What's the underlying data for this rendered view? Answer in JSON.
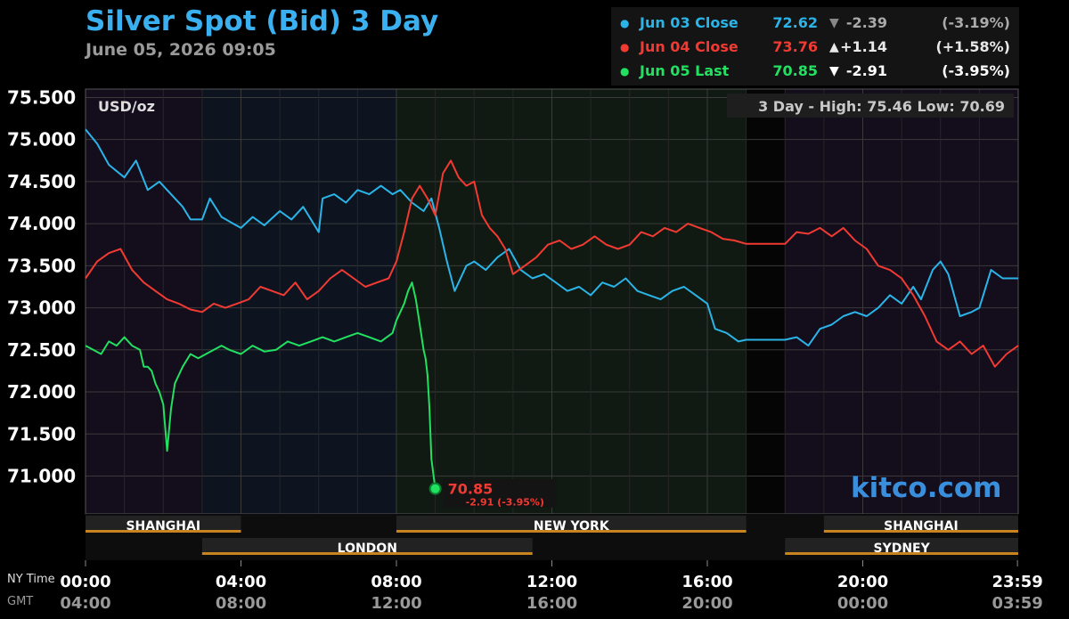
{
  "header": {
    "title": "Silver Spot (Bid) 3 Day",
    "subtitle": "June 05, 2026 09:05"
  },
  "legend": [
    {
      "name": "Jun 03 Close",
      "value": "72.62",
      "arrow": "▼",
      "change": "-2.39",
      "pct": "(-3.19%)",
      "color": "#2ab4e8",
      "arrow_color": "#888888",
      "change_color": "#aaaaaa"
    },
    {
      "name": "Jun 04 Close",
      "value": "73.76",
      "arrow": "▲",
      "change": "+1.14",
      "pct": "(+1.58%)",
      "color": "#f03a32",
      "arrow_color": "#e8e8e8",
      "change_color": "#e8e8e8"
    },
    {
      "name": "Jun 05 Last",
      "value": "70.85",
      "arrow": "▼",
      "change": "-2.91",
      "pct": "(-3.95%)",
      "color": "#22e060",
      "arrow_color": "#ffffff",
      "change_color": "#ffffff"
    }
  ],
  "brand": "kitco.com",
  "chart_data": {
    "type": "line",
    "unit_label": "USD/oz",
    "range_text": "3 Day - High: 75.46  Low: 70.69",
    "ylim": [
      70.55,
      75.6
    ],
    "xlim": [
      0,
      24
    ],
    "y_ticks": [
      {
        "v": 75.5,
        "label": "75.500"
      },
      {
        "v": 75.0,
        "label": "75.000"
      },
      {
        "v": 74.5,
        "label": "74.500"
      },
      {
        "v": 74.0,
        "label": "74.000"
      },
      {
        "v": 73.5,
        "label": "73.500"
      },
      {
        "v": 73.0,
        "label": "73.000"
      },
      {
        "v": 72.5,
        "label": "72.500"
      },
      {
        "v": 72.0,
        "label": "72.000"
      },
      {
        "v": 71.5,
        "label": "71.500"
      },
      {
        "v": 71.0,
        "label": "71.000"
      }
    ],
    "x_ticks": [
      {
        "v": 0,
        "ny": "00:00",
        "gmt": "04:00"
      },
      {
        "v": 4,
        "ny": "04:00",
        "gmt": "08:00"
      },
      {
        "v": 8,
        "ny": "08:00",
        "gmt": "12:00"
      },
      {
        "v": 12,
        "ny": "12:00",
        "gmt": "16:00"
      },
      {
        "v": 16,
        "ny": "16:00",
        "gmt": "20:00"
      },
      {
        "v": 20,
        "ny": "20:00",
        "gmt": "00:00"
      },
      {
        "v": 23.98,
        "ny": "23:59",
        "gmt": "03:59"
      }
    ],
    "x_row_labels": {
      "ny": "NY Time",
      "gmt": "GMT"
    },
    "sessions": [
      {
        "name": "SHANGHAI",
        "start": 0,
        "end": 4,
        "row": 1
      },
      {
        "name": "LONDON",
        "start": 3,
        "end": 11.5,
        "row": 2
      },
      {
        "name": "NEW YORK",
        "start": 8,
        "end": 17,
        "row": 1
      },
      {
        "name": "SHANGHAI",
        "start": 19,
        "end": 24,
        "row": 1
      },
      {
        "name": "SYDNEY",
        "start": 18,
        "end": 24,
        "row": 2
      }
    ],
    "session_shading": [
      {
        "start": 0,
        "end": 3,
        "color": "#140d1c"
      },
      {
        "start": 3,
        "end": 8,
        "color": "#0d1420"
      },
      {
        "start": 8,
        "end": 17,
        "color": "#101a12"
      },
      {
        "start": 17,
        "end": 18,
        "color": "#050505"
      },
      {
        "start": 18,
        "end": 24,
        "color": "#140d1c"
      }
    ],
    "series": [
      {
        "name": "Jun 03 Close",
        "color": "#2ab4e8",
        "x": [
          0,
          0.3,
          0.6,
          1.0,
          1.3,
          1.6,
          1.9,
          2.2,
          2.5,
          2.7,
          3.0,
          3.2,
          3.5,
          3.8,
          4.0,
          4.3,
          4.6,
          5.0,
          5.3,
          5.6,
          6.0,
          6.1,
          6.4,
          6.7,
          7.0,
          7.3,
          7.6,
          7.9,
          8.1,
          8.4,
          8.7,
          8.9,
          9.1,
          9.3,
          9.5,
          9.8,
          10.0,
          10.3,
          10.6,
          10.9,
          11.2,
          11.5,
          11.8,
          12.1,
          12.4,
          12.7,
          13.0,
          13.3,
          13.6,
          13.9,
          14.2,
          14.5,
          14.8,
          15.1,
          15.4,
          15.7,
          16.0,
          16.2,
          16.5,
          16.8,
          17.0,
          17.5,
          18.0,
          18.3,
          18.6,
          18.9,
          19.2,
          19.5,
          19.8,
          20.1,
          20.4,
          20.7,
          21.0,
          21.3,
          21.5,
          21.8,
          22.0,
          22.2,
          22.5,
          22.8,
          23.0,
          23.3,
          23.6,
          24.0
        ],
        "y": [
          75.12,
          74.95,
          74.7,
          74.55,
          74.75,
          74.4,
          74.5,
          74.35,
          74.2,
          74.05,
          74.05,
          74.3,
          74.08,
          74.0,
          73.95,
          74.08,
          73.98,
          74.15,
          74.05,
          74.2,
          73.9,
          74.3,
          74.35,
          74.25,
          74.4,
          74.35,
          74.45,
          74.35,
          74.4,
          74.25,
          74.15,
          74.3,
          73.95,
          73.55,
          73.2,
          73.5,
          73.55,
          73.45,
          73.6,
          73.7,
          73.45,
          73.35,
          73.4,
          73.3,
          73.2,
          73.25,
          73.15,
          73.3,
          73.25,
          73.35,
          73.2,
          73.15,
          73.1,
          73.2,
          73.25,
          73.15,
          73.05,
          72.75,
          72.7,
          72.6,
          72.62,
          72.62,
          72.62,
          72.65,
          72.55,
          72.75,
          72.8,
          72.9,
          72.95,
          72.9,
          73.0,
          73.15,
          73.05,
          73.25,
          73.1,
          73.45,
          73.55,
          73.4,
          72.9,
          72.95,
          73.0,
          73.45,
          73.35,
          73.35
        ]
      },
      {
        "name": "Jun 04 Close",
        "color": "#f03a32",
        "x": [
          0,
          0.3,
          0.6,
          0.9,
          1.2,
          1.5,
          1.8,
          2.1,
          2.4,
          2.7,
          3.0,
          3.3,
          3.6,
          3.9,
          4.2,
          4.5,
          4.8,
          5.1,
          5.4,
          5.7,
          6.0,
          6.3,
          6.6,
          6.9,
          7.2,
          7.5,
          7.8,
          8.0,
          8.2,
          8.4,
          8.6,
          8.8,
          9.0,
          9.2,
          9.4,
          9.6,
          9.8,
          10.0,
          10.2,
          10.4,
          10.6,
          10.8,
          11.0,
          11.3,
          11.6,
          11.9,
          12.2,
          12.5,
          12.8,
          13.1,
          13.4,
          13.7,
          14.0,
          14.3,
          14.6,
          14.9,
          15.2,
          15.5,
          15.8,
          16.1,
          16.4,
          16.7,
          17.0,
          17.5,
          18.0,
          18.3,
          18.6,
          18.9,
          19.2,
          19.5,
          19.8,
          20.1,
          20.4,
          20.7,
          21.0,
          21.3,
          21.6,
          21.9,
          22.2,
          22.5,
          22.8,
          23.1,
          23.4,
          23.7,
          24.0
        ],
        "y": [
          73.35,
          73.55,
          73.65,
          73.7,
          73.45,
          73.3,
          73.2,
          73.1,
          73.05,
          72.98,
          72.95,
          73.05,
          73.0,
          73.05,
          73.1,
          73.25,
          73.2,
          73.15,
          73.3,
          73.1,
          73.2,
          73.35,
          73.45,
          73.35,
          73.25,
          73.3,
          73.35,
          73.55,
          73.9,
          74.3,
          74.45,
          74.3,
          74.1,
          74.6,
          74.75,
          74.55,
          74.45,
          74.5,
          74.1,
          73.95,
          73.85,
          73.7,
          73.4,
          73.5,
          73.6,
          73.75,
          73.8,
          73.7,
          73.75,
          73.85,
          73.75,
          73.7,
          73.75,
          73.9,
          73.85,
          73.95,
          73.9,
          74.0,
          73.95,
          73.9,
          73.82,
          73.8,
          73.76,
          73.76,
          73.76,
          73.9,
          73.88,
          73.95,
          73.85,
          73.95,
          73.8,
          73.7,
          73.5,
          73.45,
          73.35,
          73.15,
          72.9,
          72.6,
          72.5,
          72.6,
          72.45,
          72.55,
          72.3,
          72.45,
          72.55
        ]
      },
      {
        "name": "Jun 05 Last",
        "color": "#22e060",
        "x": [
          0,
          0.2,
          0.4,
          0.6,
          0.8,
          1.0,
          1.2,
          1.4,
          1.5,
          1.6,
          1.7,
          1.8,
          1.9,
          2.0,
          2.1,
          2.2,
          2.3,
          2.5,
          2.7,
          2.9,
          3.1,
          3.3,
          3.5,
          3.7,
          4.0,
          4.3,
          4.6,
          4.9,
          5.2,
          5.5,
          5.8,
          6.1,
          6.4,
          6.7,
          7.0,
          7.3,
          7.6,
          7.9,
          8.0,
          8.1,
          8.2,
          8.3,
          8.4,
          8.5,
          8.6,
          8.7,
          8.75,
          8.8,
          8.85,
          8.9,
          9.0
        ],
        "y": [
          72.55,
          72.5,
          72.45,
          72.6,
          72.55,
          72.65,
          72.55,
          72.5,
          72.3,
          72.3,
          72.25,
          72.1,
          72.0,
          71.85,
          71.3,
          71.8,
          72.1,
          72.3,
          72.45,
          72.4,
          72.45,
          72.5,
          72.55,
          72.5,
          72.45,
          72.55,
          72.48,
          72.5,
          72.6,
          72.55,
          72.6,
          72.65,
          72.6,
          72.65,
          72.7,
          72.65,
          72.6,
          72.7,
          72.85,
          72.95,
          73.05,
          73.2,
          73.3,
          73.1,
          72.8,
          72.5,
          72.4,
          72.2,
          71.8,
          71.2,
          70.85
        ]
      }
    ],
    "last_point": {
      "x": 9.0,
      "y": 70.85,
      "label": "70.85",
      "sub": "-2.91 (-3.95%)",
      "label_color": "#f03a32"
    }
  }
}
